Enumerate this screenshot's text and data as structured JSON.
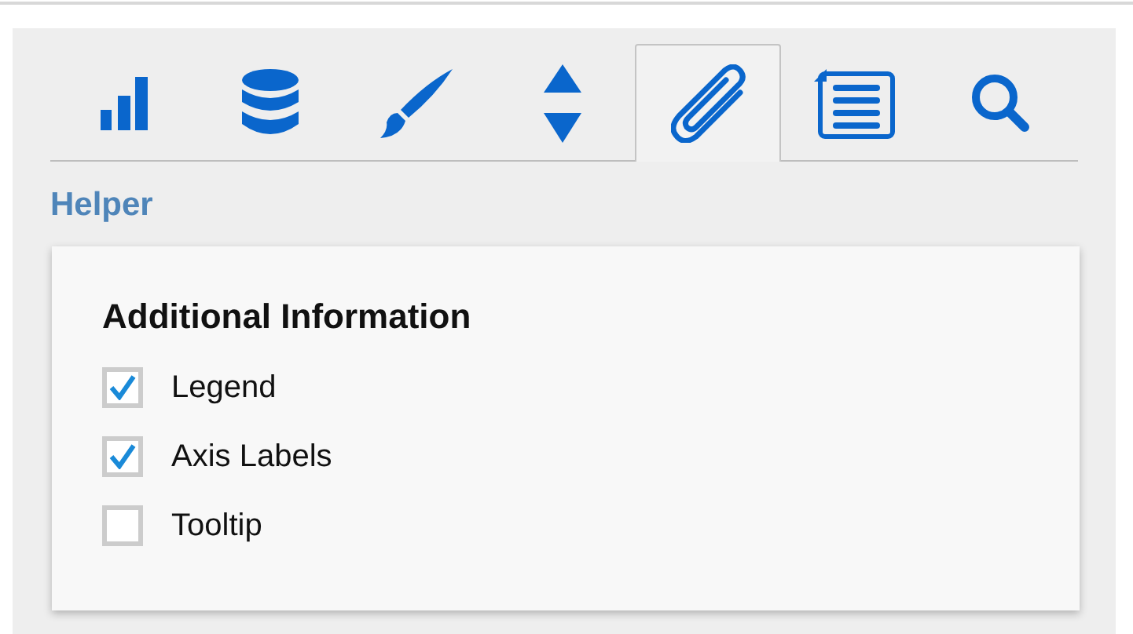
{
  "tabs": [
    {
      "kind": "chart",
      "selected": false
    },
    {
      "kind": "data",
      "selected": false
    },
    {
      "kind": "style",
      "selected": false
    },
    {
      "kind": "sort",
      "selected": false
    },
    {
      "kind": "attach",
      "selected": true
    },
    {
      "kind": "list",
      "selected": false
    },
    {
      "kind": "search",
      "selected": false
    }
  ],
  "section": {
    "title": "Helper"
  },
  "card": {
    "title": "Additional Information",
    "options": [
      {
        "label": "Legend",
        "checked": true
      },
      {
        "label": "Axis Labels",
        "checked": true
      },
      {
        "label": "Tooltip",
        "checked": false
      }
    ]
  }
}
